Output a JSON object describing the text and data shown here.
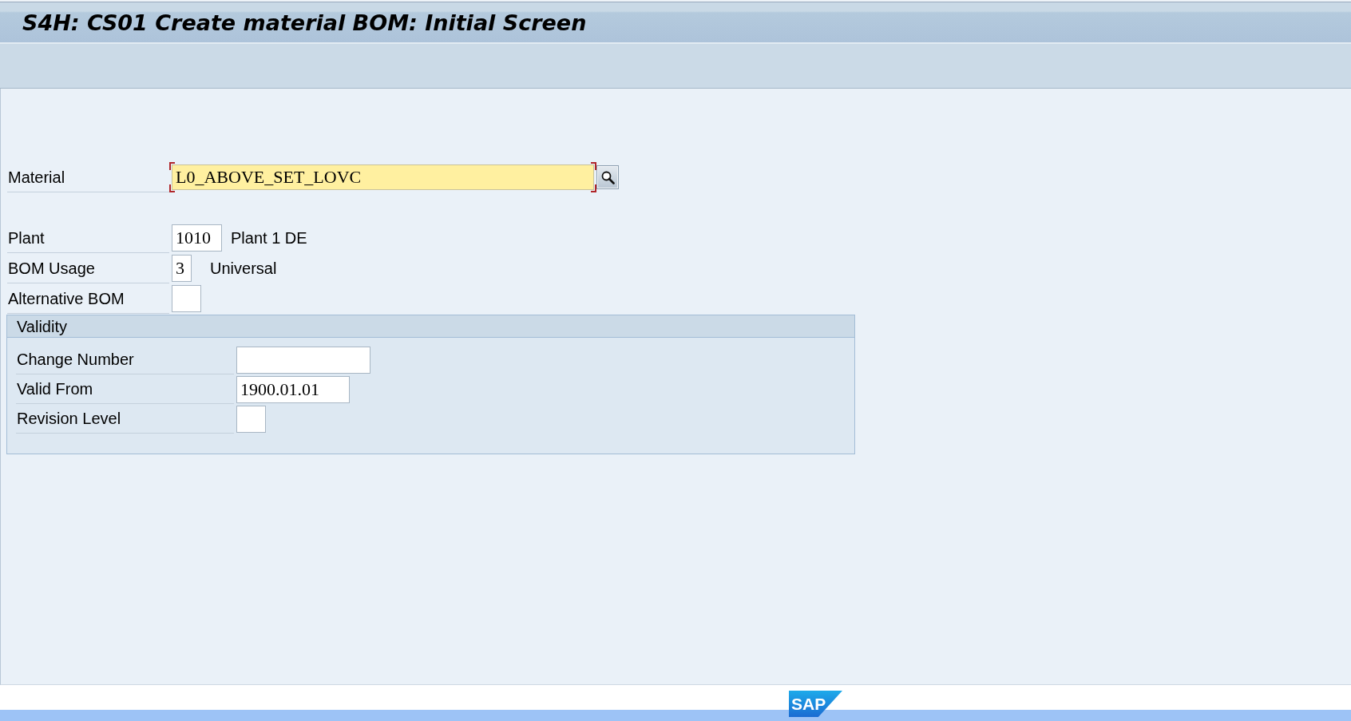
{
  "window": {
    "title": "S4H: CS01 Create material BOM: Initial Screen"
  },
  "fields": [
    {
      "label": "Material",
      "value": "L0_ABOVE_SET_LOVC",
      "focused": true,
      "search_help": true
    },
    {
      "label": "Plant",
      "value": "1010",
      "description": "Plant 1 DE",
      "focused": false,
      "search_help": false
    },
    {
      "label": "BOM Usage",
      "value": "3",
      "description": "Universal",
      "focused": false,
      "search_help": false
    },
    {
      "label": "Alternative BOM",
      "focused": false,
      "search_help": false
    }
  ],
  "validity": {
    "title": "Validity",
    "fields": [
      {
        "label": "Change Number",
        "focused": false,
        "search_help": false
      },
      {
        "label": "Valid From",
        "value": "1900.01.01",
        "focused": false,
        "search_help": false
      },
      {
        "label": "Revision Level",
        "focused": false,
        "search_help": false
      }
    ]
  },
  "footer": {
    "logo": "SAP"
  }
}
